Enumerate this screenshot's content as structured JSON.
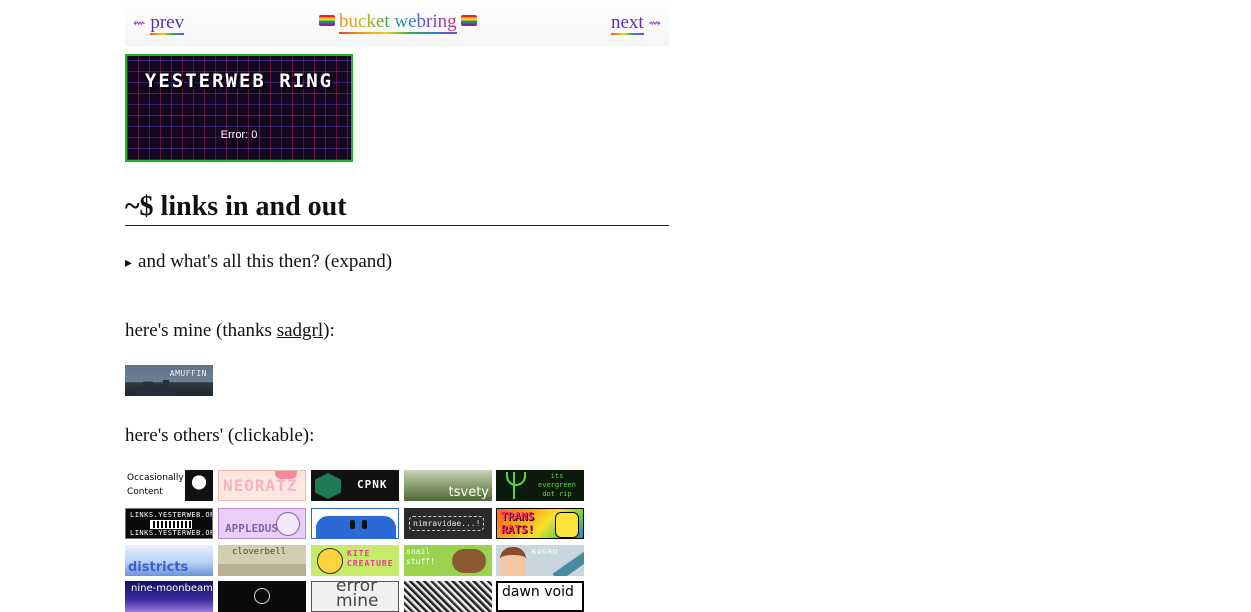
{
  "webring": {
    "prev_label": "prev",
    "prev_arrow": "⇜",
    "name": "bucket webring",
    "next_label": "next",
    "next_arrow": "⇝"
  },
  "yesterweb_widget": {
    "title": "YESTERWEB RING",
    "status": "Error: 0",
    "border_color": "#1fb824"
  },
  "heading": "~$ links in and out",
  "details_summary": "and what's all this then? (expand)",
  "mine": {
    "text_before": "here's mine (thanks ",
    "link_text": "sadgrl",
    "text_after": "):",
    "button_text": "AMUFFIN"
  },
  "others_label": "here's others' (clickable):",
  "buttons": {
    "occasionally_content": "Occasionally Content",
    "neoratz": "NEORATZ",
    "cpnk": "CPNK",
    "tsvety": "tsvety",
    "evergreen": "its evergreen dot rip",
    "links_yesterweb_1": "LINKS.YESTERWEB.ORG",
    "links_yesterweb_2": "LINKS.YESTERWEB.ORG",
    "appledust": "APPLEDUST",
    "nimravidae": "nimravidae...!",
    "transrats": "TRANS RATS!",
    "districts": "districts",
    "cloverbell": "cloverbell",
    "kitecreature": "KITE CREATURE",
    "snailstuff": "snail stuff!",
    "kaoru": "KAORU",
    "ninemoonbeams": "nine-moonbeams",
    "errormine": "error mine",
    "dawnvoid": "dawn void"
  }
}
